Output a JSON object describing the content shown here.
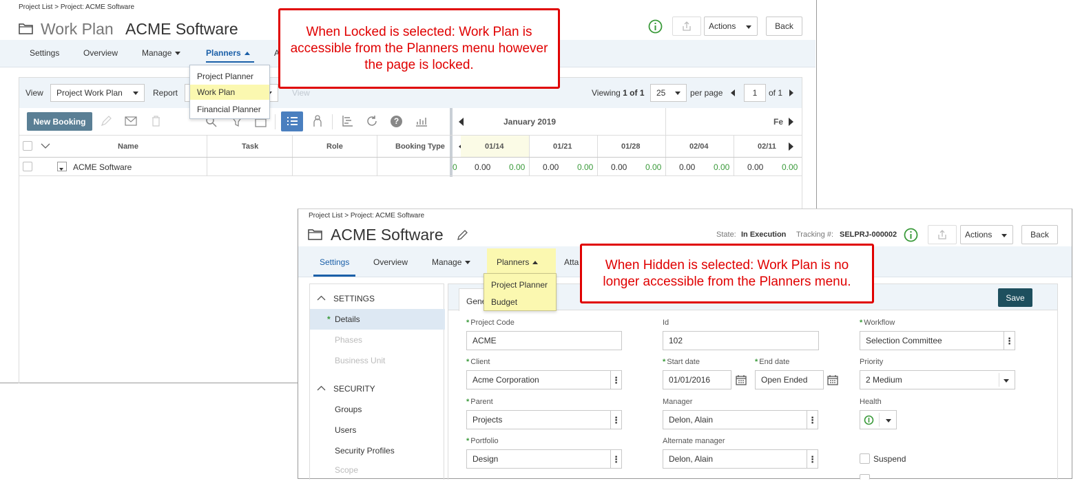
{
  "top": {
    "breadcrumb": "Project List > Project: ACME Software",
    "title_module": "Work Plan",
    "title_project": "ACME Software",
    "actions_label": "Actions",
    "back_label": "Back",
    "nav": {
      "settings": "Settings",
      "overview": "Overview",
      "manage": "Manage",
      "planners": "Planners",
      "partial": "A"
    },
    "planners_menu": [
      "Project Planner",
      "Work Plan",
      "Financial Planner"
    ],
    "toolbar": {
      "view_label": "View",
      "view_value": "Project Work Plan",
      "report_label": "Report",
      "view_btn": "View",
      "viewing": "Viewing",
      "viewing_range": "1 of 1",
      "per_page_value": "25",
      "per_page_label": "per page",
      "page_value": "1",
      "page_of": "of 1",
      "new_booking": "New Booking"
    },
    "timeline": {
      "month": "January 2019",
      "next_month_partial": "Fe",
      "weeks": [
        "01/14",
        "01/21",
        "01/28",
        "02/04",
        "02/11"
      ]
    },
    "columns": [
      "Name",
      "Task",
      "Role",
      "Booking Type"
    ],
    "rows": [
      {
        "name": "ACME Software",
        "lead": "0",
        "values": [
          "0.00",
          "0.00",
          "0.00",
          "0.00",
          "0.00",
          "0.00",
          "0.00",
          "0.00",
          "0.00",
          "0.00"
        ]
      }
    ]
  },
  "bottom": {
    "breadcrumb": "Project List > Project: ACME Software",
    "title": "ACME Software",
    "state_label": "State:",
    "state_value": "In Execution",
    "tracking_label": "Tracking #:",
    "tracking_value": "SELPRJ-000002",
    "actions_label": "Actions",
    "back_label": "Back",
    "nav": {
      "settings": "Settings",
      "overview": "Overview",
      "manage": "Manage",
      "planners": "Planners",
      "partial": "Atta"
    },
    "planners_menu": [
      "Project Planner",
      "Budget"
    ],
    "sidebar": {
      "settings_header": "SETTINGS",
      "settings_items": [
        "Details",
        "Phases",
        "Business Unit"
      ],
      "security_header": "SECURITY",
      "security_items": [
        "Groups",
        "Users",
        "Security Profiles",
        "Scope"
      ]
    },
    "tab_partial": "Gene",
    "save_label": "Save",
    "form": {
      "project_code_label": "Project Code",
      "project_code_value": "ACME",
      "id_label": "Id",
      "id_value": "102",
      "workflow_label": "Workflow",
      "workflow_value": "Selection Committee",
      "client_label": "Client",
      "client_value": "Acme Corporation",
      "start_label": "Start date",
      "start_value": "01/01/2016",
      "end_label": "End date",
      "end_value": "Open Ended",
      "priority_label": "Priority",
      "priority_value": "2 Medium",
      "parent_label": "Parent",
      "parent_value": "Projects",
      "manager_label": "Manager",
      "manager_value": "Delon, Alain",
      "health_label": "Health",
      "portfolio_label": "Portfolio",
      "portfolio_value": "Design",
      "alt_manager_label": "Alternate manager",
      "alt_manager_value": "Delon, Alain",
      "suspend_label": "Suspend"
    }
  },
  "callouts": {
    "locked": "When Locked is selected: Work Plan is accessible from the Planners menu however the page is locked.",
    "hidden": "When Hidden is selected: Work Plan is no longer accessible from the Planners menu."
  },
  "colors": {
    "accent": "#1a5fa8",
    "callout_red": "#e00000",
    "highlight_yellow": "#fbf8b0",
    "new_booking_bg": "#5a7f95",
    "save_bg": "#1e4f5e",
    "green_values": "#3a9a3a"
  }
}
